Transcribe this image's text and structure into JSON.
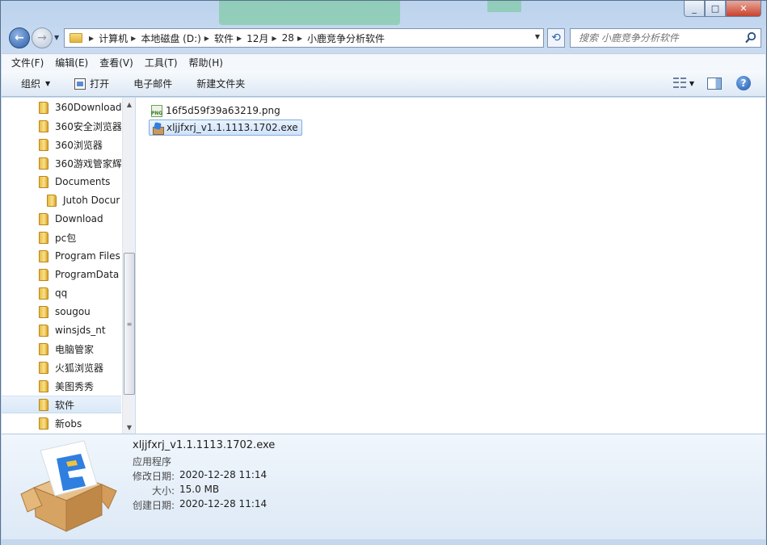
{
  "window": {
    "caption_min": "_",
    "caption_max": "□",
    "caption_close": "✕"
  },
  "address": {
    "breadcrumbs": [
      "计算机",
      "本地磁盘 (D:)",
      "软件",
      "12月",
      "28",
      "小鹿竞争分析软件"
    ],
    "search_placeholder": "搜索 小鹿竞争分析软件"
  },
  "menubar": [
    "文件(F)",
    "编辑(E)",
    "查看(V)",
    "工具(T)",
    "帮助(H)"
  ],
  "toolbar": {
    "organize": "组织",
    "open": "打开",
    "email": "电子邮件",
    "new_folder": "新建文件夹"
  },
  "nav_tree": [
    {
      "label": "360Download",
      "indent": 0
    },
    {
      "label": "360安全浏览器",
      "indent": 0
    },
    {
      "label": "360浏览器",
      "indent": 0
    },
    {
      "label": "360游戏管家辉",
      "indent": 0
    },
    {
      "label": "Documents",
      "indent": 0
    },
    {
      "label": "Jutoh Docur",
      "indent": 1
    },
    {
      "label": "Download",
      "indent": 0
    },
    {
      "label": "pc包",
      "indent": 0
    },
    {
      "label": "Program Files",
      "indent": 0
    },
    {
      "label": "ProgramData",
      "indent": 0
    },
    {
      "label": "qq",
      "indent": 0
    },
    {
      "label": "sougou",
      "indent": 0
    },
    {
      "label": "winsjds_nt",
      "indent": 0
    },
    {
      "label": "电脑管家",
      "indent": 0
    },
    {
      "label": "火狐浏览器",
      "indent": 0
    },
    {
      "label": "美图秀秀",
      "indent": 0
    },
    {
      "label": "软件",
      "indent": 0,
      "selected": true
    },
    {
      "label": "新obs",
      "indent": 0
    }
  ],
  "files": [
    {
      "name": "16f5d59f39a63219.png",
      "icon": "png-file-icon",
      "selected": false
    },
    {
      "name": "xljjfxrj_v1.1.1113.1702.exe",
      "icon": "exe-file-icon",
      "selected": true
    }
  ],
  "details": {
    "name": "xljjfxrj_v1.1.1113.1702.exe",
    "type": "应用程序",
    "modified_label": "修改日期:",
    "modified_value": "2020-12-28 11:14",
    "size_label": "大小:",
    "size_value": "15.0 MB",
    "created_label": "创建日期:",
    "created_value": "2020-12-28 11:14"
  }
}
